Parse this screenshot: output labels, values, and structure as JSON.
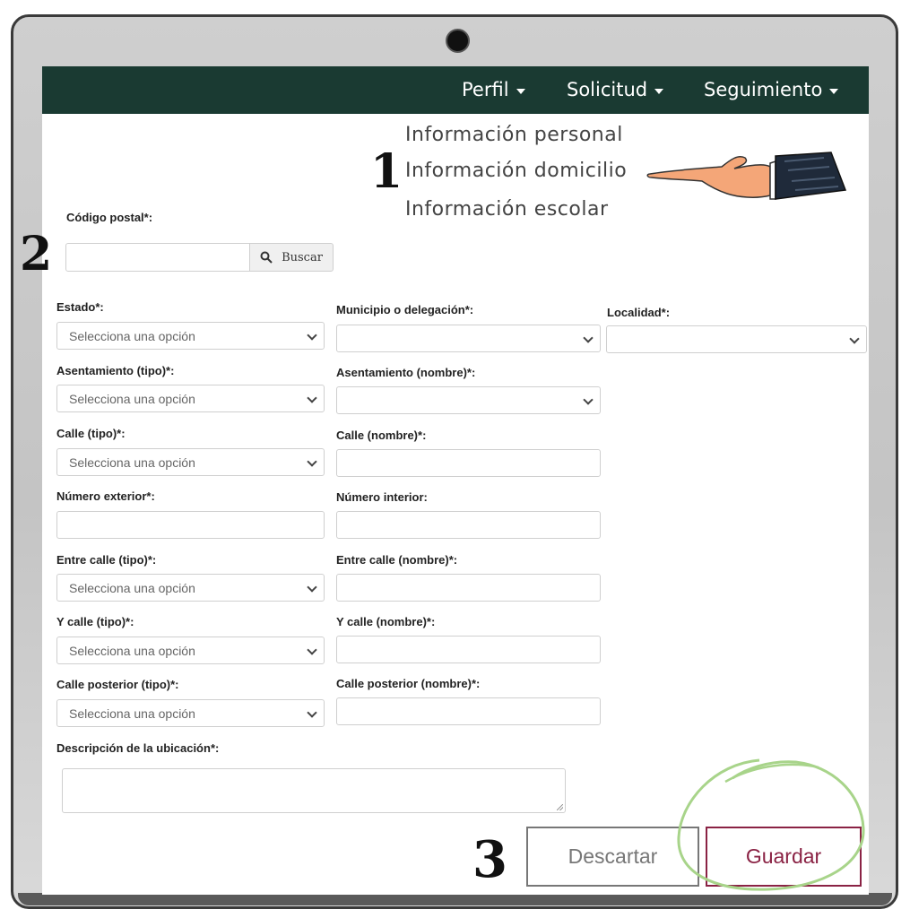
{
  "nav": {
    "items": [
      "Perfil",
      "Solicitud",
      "Seguimiento"
    ]
  },
  "submenu": {
    "items": [
      "Información personal",
      "Información domicilio",
      "Información escolar"
    ]
  },
  "steps": [
    "1",
    "2",
    "3"
  ],
  "postal": {
    "label": "Código postal*:",
    "value": "",
    "search_label": "Buscar"
  },
  "form": {
    "estado": {
      "label": "Estado*:",
      "value": "Selecciona una opción"
    },
    "municipio": {
      "label": "Municipio o delegación*:",
      "value": ""
    },
    "localidad": {
      "label": "Localidad*:",
      "value": ""
    },
    "asentamiento_tipo": {
      "label": "Asentamiento (tipo)*:",
      "value": "Selecciona una opción"
    },
    "asentamiento_nombre": {
      "label": "Asentamiento (nombre)*:",
      "value": ""
    },
    "calle_tipo": {
      "label": "Calle (tipo)*:",
      "value": "Selecciona una opción"
    },
    "calle_nombre": {
      "label": "Calle (nombre)*:",
      "value": ""
    },
    "num_exterior": {
      "label": "Número exterior*:",
      "value": ""
    },
    "num_interior": {
      "label": "Número interior:",
      "value": ""
    },
    "entre_tipo": {
      "label": "Entre calle (tipo)*:",
      "value": "Selecciona una opción"
    },
    "entre_nombre": {
      "label": "Entre calle (nombre)*:",
      "value": ""
    },
    "ycalle_tipo": {
      "label": "Y calle (tipo)*:",
      "value": "Selecciona una opción"
    },
    "ycalle_nombre": {
      "label": "Y calle (nombre)*:",
      "value": ""
    },
    "posterior_tipo": {
      "label": "Calle posterior (tipo)*:",
      "value": "Selecciona una opción"
    },
    "posterior_nombre": {
      "label": "Calle posterior (nombre)*:",
      "value": ""
    },
    "descripcion": {
      "label": "Descripción de la ubicación*:",
      "value": ""
    }
  },
  "actions": {
    "discard": "Descartar",
    "save": "Guardar"
  },
  "colors": {
    "navbar": "#1a3a32",
    "save": "#8a2244",
    "highlight_circle": "#a8d48a"
  },
  "icons": [
    "camera",
    "caret-down-icon",
    "search-icon",
    "chevron-down-icon",
    "pointing-hand-icon",
    "highlight-circle"
  ]
}
